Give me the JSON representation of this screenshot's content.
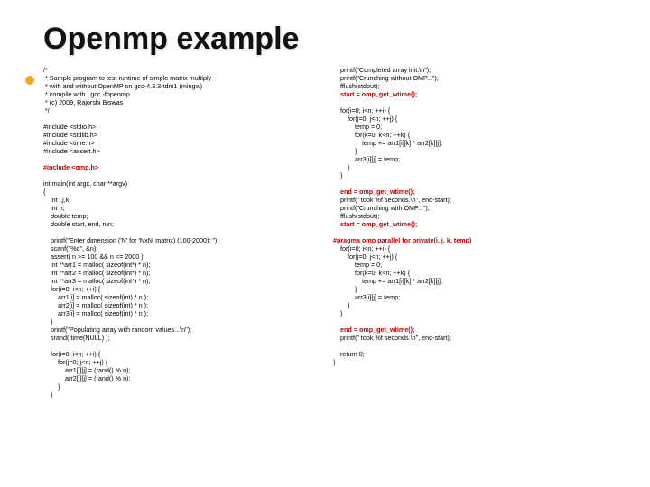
{
  "title": "Openmp example",
  "left": {
    "l1": "/*",
    "l2": " * Sample program to test runtime of simple matrix multiply",
    "l3": " * with and without OpenMP on gcc-4.3.3-tdm1 (mingw)",
    "l4": " * compile with   gcc -fopenmp",
    "l5": " * (c) 2009, Rajorshi Biswas",
    "l6": " */",
    "l7": "#include <stdio.h>",
    "l8": "#include <stdlib.h>",
    "l9": "#include <time.h>",
    "l10": "#include <assert.h>",
    "l11": "#include <omp.h>",
    "l12": "int main(int argc, char **argv)",
    "l13": "{",
    "l14": "    int i,j,k;",
    "l15": "    int n;",
    "l16": "    double temp;",
    "l17": "    double start, end, run;",
    "l18": "    printf(\"Enter dimension ('N' for 'NxN' matrix) (100-2000): \");",
    "l19": "    scanf(\"%d\", &n);",
    "l20": "    assert( n >= 100 && n <= 2000 );",
    "l21": "    int **arr1 = malloc( sizeof(int*) * n);",
    "l22": "    int **arr2 = malloc( sizeof(int*) * n);",
    "l23": "    int **arr3 = malloc( sizeof(int*) * n);",
    "l24": "    for(i=0; i<n; ++i) {",
    "l25": "        arr1[i] = malloc( sizeof(int) * n );",
    "l26": "        arr2[i] = malloc( sizeof(int) * n );",
    "l27": "        arr3[i] = malloc( sizeof(int) * n );",
    "l28": "    }",
    "l29": "    printf(\"Populating array with random values...\\n\");",
    "l30": "    srand( time(NULL) );",
    "l31": "    for(i=0; i<n; ++i) {",
    "l32": "        for(j=0; j<n; ++j) {",
    "l33": "            arr1[i][j] = (rand() % n);",
    "l34": "            arr2[i][j] = (rand() % n);",
    "l35": "        }",
    "l36": "    }"
  },
  "right": {
    "r1": "    printf(\"Completed array init.\\n\");",
    "r2": "    printf(\"Crunching without OMP...\");",
    "r3": "    fflush(stdout);",
    "r4": "    start = omp_get_wtime();",
    "r5": "    for(i=0; i<n; ++i) {",
    "r6": "        for(j=0; j<n; ++j) {",
    "r7": "            temp = 0;",
    "r8": "            for(k=0; k<n; ++k) {",
    "r9": "                temp += arr1[i][k] * arr2[k][j];",
    "r10": "            }",
    "r11": "            arr3[i][j] = temp;",
    "r12": "        }",
    "r13": "    }",
    "r14": "    end = omp_get_wtime();",
    "r15": "    printf(\" took %f seconds.\\n\", end-start);",
    "r16": "    printf(\"Crunching with OMP...\");",
    "r17": "    fflush(stdout);",
    "r18": "    start = omp_get_wtime();",
    "r19": "#pragma omp parallel for private(i, j, k, temp)",
    "r20": "    for(i=0; i<n; ++i) {",
    "r21": "        for(j=0; j<n; ++j) {",
    "r22": "            temp = 0;",
    "r23": "            for(k=0; k<n; ++k) {",
    "r24": "                temp += arr1[i][k] * arr2[k][j];",
    "r25": "            }",
    "r26": "            arr3[i][j] = temp;",
    "r27": "        }",
    "r28": "    }",
    "r29": "    end = omp_get_wtime();",
    "r30": "    printf(\" took %f seconds.\\n\", end-start);",
    "r31": "    return 0;",
    "r32": "}"
  }
}
